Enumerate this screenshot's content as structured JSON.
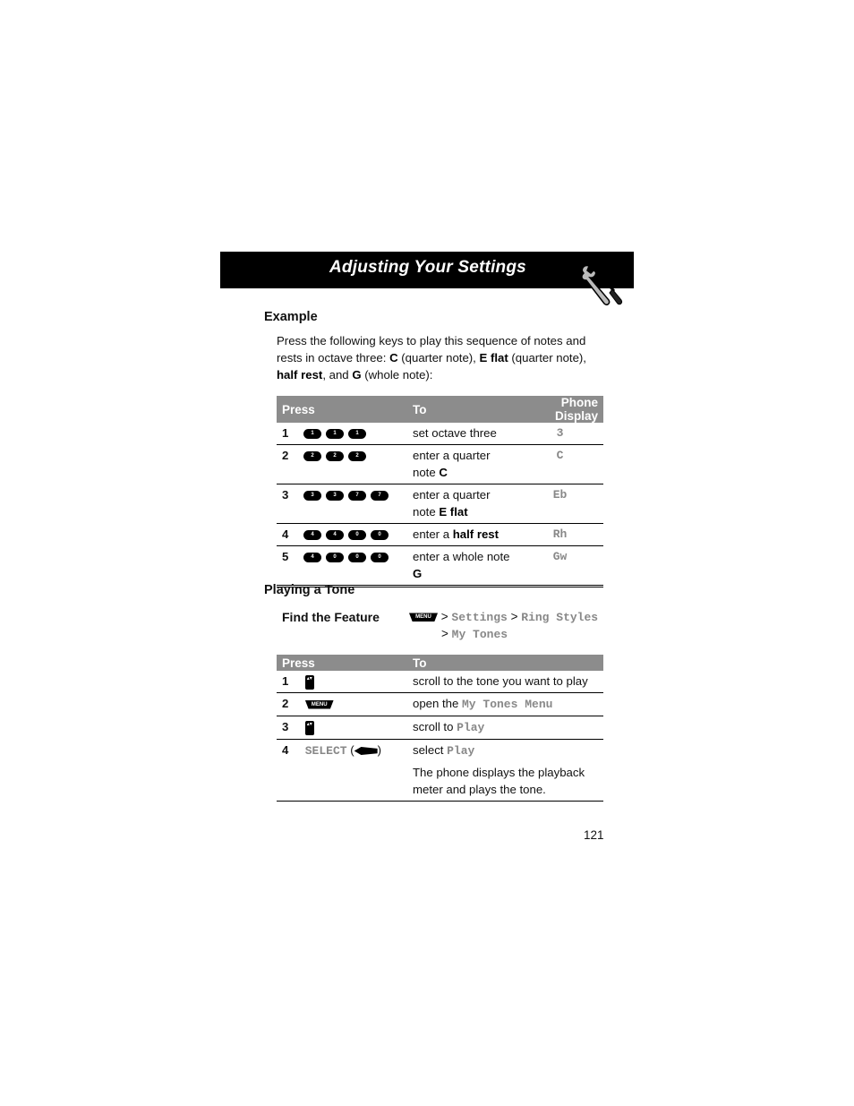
{
  "header": {
    "title": "Adjusting Your Settings",
    "icon": "wrench-screwdriver-icon"
  },
  "example": {
    "heading": "Example",
    "paragraph": [
      {
        "text": "Press the following keys to play this sequence of notes and rests in octave three: ",
        "em": false
      },
      {
        "text": "C",
        "em": true
      },
      {
        "text": " (quarter note), ",
        "em": false
      },
      {
        "text": "E flat",
        "em": true
      },
      {
        "text": " (quarter note), ",
        "em": false
      },
      {
        "text": "half rest",
        "em": true
      },
      {
        "text": ", and ",
        "em": false
      },
      {
        "text": "G",
        "em": true
      },
      {
        "text": " (whole note):",
        "em": false
      }
    ],
    "table": {
      "headers": [
        "Press",
        "To",
        "Phone Display"
      ],
      "rows": [
        {
          "num": "1",
          "keys": [
            "1",
            "1",
            "1"
          ],
          "to": [
            {
              "t": "set octave three",
              "em": false
            }
          ],
          "display": "3"
        },
        {
          "num": "2",
          "keys": [
            "2",
            "2",
            "2"
          ],
          "to": [
            {
              "t": "enter a quarter note ",
              "em": false
            },
            {
              "t": "C",
              "em": true
            }
          ],
          "display": "C"
        },
        {
          "num": "3",
          "keys": [
            "3",
            "3",
            "7",
            "7"
          ],
          "to": [
            {
              "t": "enter a quarter note ",
              "em": false
            },
            {
              "t": "E flat",
              "em": true
            }
          ],
          "display": "Eb"
        },
        {
          "num": "4",
          "keys": [
            "4",
            "4",
            "0",
            "0"
          ],
          "to": [
            {
              "t": "enter a ",
              "em": false
            },
            {
              "t": "half rest",
              "em": true
            }
          ],
          "display": "Rh"
        },
        {
          "num": "5",
          "keys": [
            "4",
            "0",
            "0",
            "0"
          ],
          "to": [
            {
              "t": "enter a whole note ",
              "em": false
            },
            {
              "t": "G",
              "em": true
            }
          ],
          "display": "Gw"
        }
      ]
    }
  },
  "playing": {
    "heading": "Playing a Tone",
    "find_label": "Find the Feature",
    "menu_key_label": "MENU",
    "path": [
      "Settings",
      "Ring Styles",
      "My Tones"
    ],
    "separator": ">",
    "table": {
      "headers": [
        "Press",
        "To"
      ],
      "rows": [
        {
          "num": "1",
          "key": "nav",
          "to_text": "scroll to the tone you want to play",
          "to_mono": ""
        },
        {
          "num": "2",
          "key": "menu",
          "to_text": "open the ",
          "to_mono": "My Tones Menu"
        },
        {
          "num": "3",
          "key": "nav",
          "to_text": "scroll to ",
          "to_mono": "Play"
        },
        {
          "num": "4",
          "key": "select",
          "key_label": "SELECT",
          "to_text": "select ",
          "to_mono": "Play",
          "note": "The phone displays the playback meter and plays the tone."
        }
      ]
    }
  },
  "page_number": "121"
}
